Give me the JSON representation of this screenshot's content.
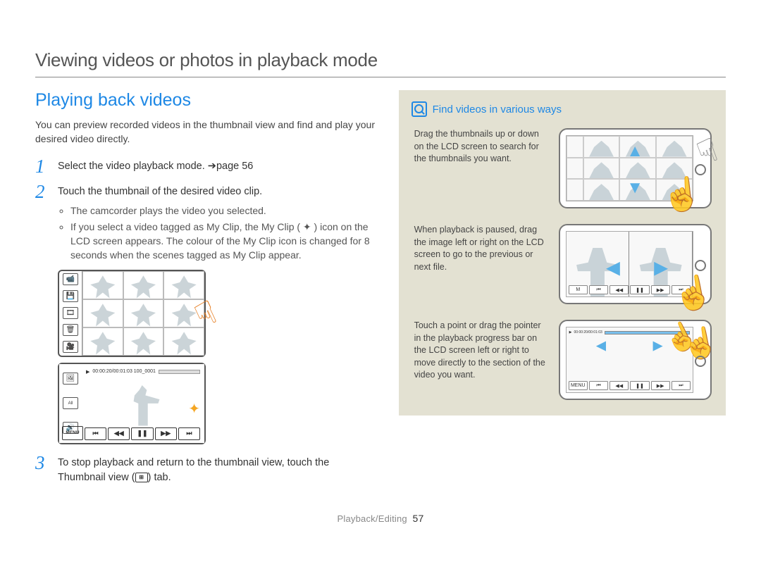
{
  "title": "Viewing videos or photos in playback mode",
  "subtitle": "Playing back videos",
  "intro": "You can preview recorded videos in the thumbnail view and find and play your desired video directly.",
  "steps": [
    {
      "num": "1",
      "text": "Select the video playback mode. ➔page 56"
    },
    {
      "num": "2",
      "text": "Touch the thumbnail of the desired video clip.",
      "bullets": [
        "The camcorder plays the video you selected.",
        "If you select a video tagged as My Clip, the My Clip ( ✦ ) icon on the LCD screen appears. The colour of the My Clip icon is changed for 8 seconds when the scenes tagged as My Clip appear."
      ]
    },
    {
      "num": "3",
      "text_pre": "To stop playback and return to the thumbnail view, touch the Thumbnail view (",
      "text_post": ") tab."
    }
  ],
  "playback_bar": {
    "time": "00:00:20/00:01:03  100_0001",
    "menu": "MENU"
  },
  "controls": [
    "⏮",
    "◀◀",
    "❚❚",
    "▶▶",
    "⏭"
  ],
  "info_title": "Find videos in various ways",
  "tips": [
    "Drag the thumbnails up or down on the LCD screen to search for the thumbnails you want.",
    "When playback is paused, drag the image left or right on the LCD screen to go to the previous or next file.",
    "Touch a point or drag the pointer in the playback progress bar on the LCD screen left or right to move directly to the section of the video you want."
  ],
  "footer_section": "Playback/Editing",
  "footer_page": "57"
}
